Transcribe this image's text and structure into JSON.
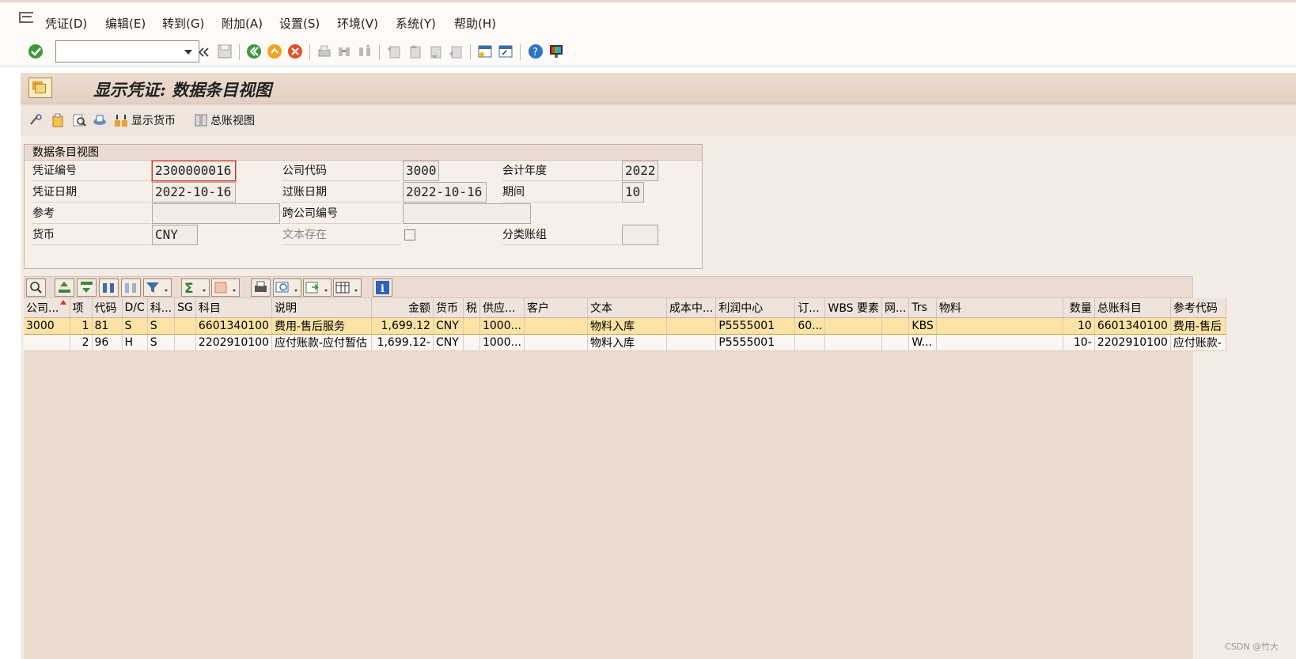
{
  "menu": {
    "items": [
      {
        "label": "凭证(D)"
      },
      {
        "label": "编辑(E)"
      },
      {
        "label": "转到(G)"
      },
      {
        "label": "附加(A)"
      },
      {
        "label": "设置(S)"
      },
      {
        "label": "环境(V)"
      },
      {
        "label": "系统(Y)"
      },
      {
        "label": "帮助(H)"
      }
    ]
  },
  "toolbar": {
    "command_field_value": ""
  },
  "title": "显示凭证: 数据条目视图",
  "app_toolbar": {
    "display_currency": "显示货币",
    "general_ledger_view": "总账视图"
  },
  "form": {
    "group_title": "数据条目视图",
    "doc_number_label": "凭证编号",
    "doc_number": "2300000016",
    "company_code_label": "公司代码",
    "company_code": "3000",
    "fiscal_year_label": "会计年度",
    "fiscal_year": "2022",
    "doc_date_label": "凭证日期",
    "doc_date": "2022-10-16",
    "posting_date_label": "过账日期",
    "posting_date": "2022-10-16",
    "period_label": "期间",
    "period": "10",
    "reference_label": "参考",
    "reference": "",
    "cross_company_label": "跨公司编号",
    "cross_company": "",
    "currency_label": "货币",
    "currency": "CNY",
    "text_exists_label": "文本存在",
    "ledger_group_label": "分类账组",
    "ledger_group": ""
  },
  "grid": {
    "columns": [
      "公司...",
      "项",
      "代码",
      "D/C",
      "科...",
      "SG",
      "科目",
      "说明",
      "金额",
      "货币",
      "税",
      "供应...",
      "客户",
      "文本",
      "成本中...",
      "利润中心",
      "订...",
      "WBS 要素",
      "网...",
      "Trs",
      "物料",
      "数量",
      "总账科目",
      "参考代码"
    ],
    "rows": [
      [
        "3000",
        "1",
        "81",
        "S",
        "S",
        "",
        "6601340100",
        "费用-售后服务",
        "1,699.12",
        "CNY",
        "",
        "1000...",
        "",
        "物料入库",
        "",
        "P5555001",
        "60...",
        "",
        "",
        "KBS",
        "",
        "10",
        "6601340100",
        "费用-售后"
      ],
      [
        "",
        "2",
        "96",
        "H",
        "S",
        "",
        "2202910100",
        "应付账款-应付暂估",
        "1,699.12-",
        "CNY",
        "",
        "1000...",
        "",
        "物料入库",
        "",
        "P5555001",
        "",
        "",
        "",
        "W...",
        "",
        "10-",
        "2202910100",
        "应付账款-"
      ]
    ]
  },
  "watermark": "CSDN @竹大"
}
